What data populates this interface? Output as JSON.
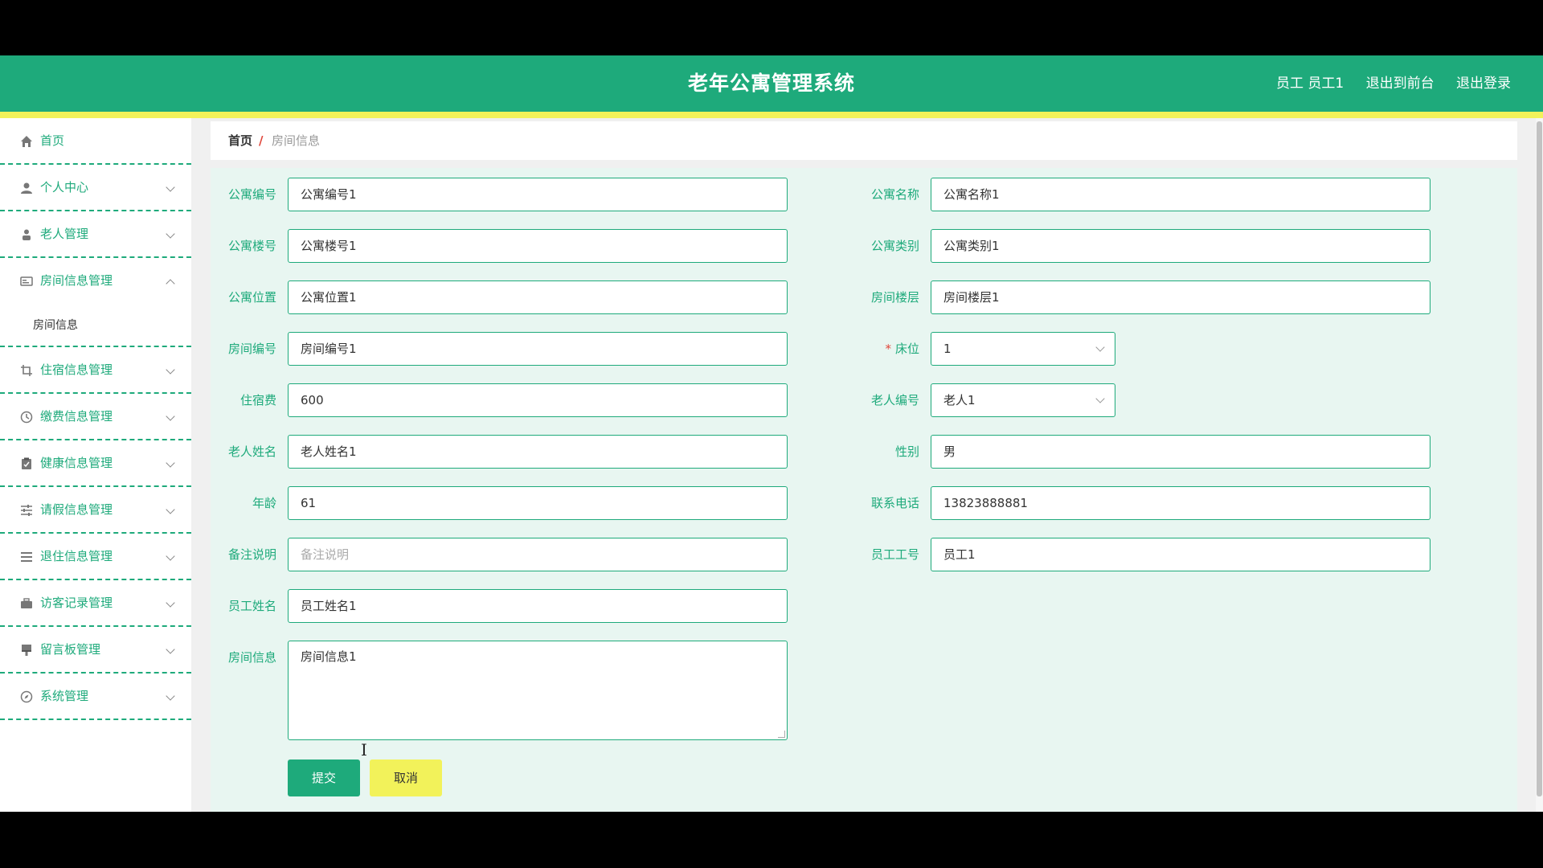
{
  "header": {
    "title": "老年公寓管理系统",
    "user": "员工 员工1",
    "to_frontend": "退出到前台",
    "logout": "退出登录"
  },
  "colors": {
    "primary": "#1eaa7b",
    "accent_yellow": "#f2f25a",
    "danger": "#e0463a"
  },
  "sidebar": {
    "items": [
      {
        "label": "首页",
        "icon": "home-icon"
      },
      {
        "label": "个人中心",
        "icon": "user-icon"
      },
      {
        "label": "老人管理",
        "icon": "person-icon"
      },
      {
        "label": "房间信息管理",
        "icon": "card-icon",
        "expanded": true,
        "sub": "房间信息"
      },
      {
        "label": "住宿信息管理",
        "icon": "crop-icon"
      },
      {
        "label": "缴费信息管理",
        "icon": "clock-icon"
      },
      {
        "label": "健康信息管理",
        "icon": "clipboard-icon"
      },
      {
        "label": "请假信息管理",
        "icon": "sliders-icon"
      },
      {
        "label": "退住信息管理",
        "icon": "list-icon"
      },
      {
        "label": "访客记录管理",
        "icon": "briefcase-icon"
      },
      {
        "label": "留言板管理",
        "icon": "brush-icon"
      },
      {
        "label": "系统管理",
        "icon": "compass-icon"
      }
    ]
  },
  "breadcrumb": {
    "home": "首页",
    "separator": "/",
    "current": "房间信息"
  },
  "form": {
    "apartment_no": {
      "label": "公寓编号",
      "value": "公寓编号1"
    },
    "apartment_name": {
      "label": "公寓名称",
      "value": "公寓名称1"
    },
    "building_no": {
      "label": "公寓楼号",
      "value": "公寓楼号1"
    },
    "apartment_type": {
      "label": "公寓类别",
      "value": "公寓类别1"
    },
    "location": {
      "label": "公寓位置",
      "value": "公寓位置1"
    },
    "room_floor": {
      "label": "房间楼层",
      "value": "房间楼层1"
    },
    "room_no": {
      "label": "房间编号",
      "value": "房间编号1"
    },
    "bed": {
      "label": "床位",
      "required_mark": "*",
      "value": "1"
    },
    "fee": {
      "label": "住宿费",
      "value": "600"
    },
    "elder_no": {
      "label": "老人编号",
      "value": "老人1"
    },
    "elder_name": {
      "label": "老人姓名",
      "value": "老人姓名1"
    },
    "gender": {
      "label": "性别",
      "value": "男"
    },
    "age": {
      "label": "年龄",
      "value": "61"
    },
    "phone": {
      "label": "联系电话",
      "value": "13823888881"
    },
    "remark": {
      "label": "备注说明",
      "placeholder": "备注说明"
    },
    "staff_no": {
      "label": "员工工号",
      "value": "员工1"
    },
    "staff_name": {
      "label": "员工姓名",
      "value": "员工姓名1"
    },
    "room_info": {
      "label": "房间信息",
      "value": "房间信息1"
    },
    "submit": "提交",
    "cancel": "取消"
  }
}
